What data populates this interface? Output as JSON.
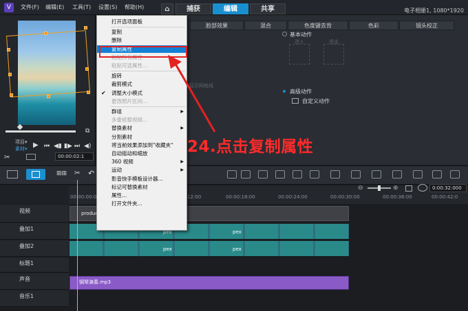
{
  "titlebar": {
    "menus": [
      "文件(F)",
      "编辑(E)",
      "工具(T)",
      "设置(S)",
      "帮助(H)"
    ],
    "home_icon": "home-icon",
    "tabs": [
      "捕获",
      "编辑",
      "共享"
    ],
    "active_tab": "编辑",
    "project_info": "电子相册1, 1080*1920"
  },
  "preview": {
    "labels": {
      "project": "项目▾",
      "clip": "素材▾"
    },
    "timecode": "00:00:02:1"
  },
  "panel": {
    "tabs": [
      "脸部效果",
      "混合",
      "色度键去背",
      "色彩",
      "镜头校正"
    ],
    "basic_motion": "基本动作",
    "enter_label": "进入",
    "exit_label": "退出",
    "show_grid": "显示网格线",
    "advanced_motion": "高级动作",
    "custom_motion": "自定义动作"
  },
  "context_menu": {
    "items": [
      {
        "label": "打开选项面板",
        "disabled": false,
        "submenu": false
      },
      {
        "label": "复制",
        "disabled": false,
        "submenu": false
      },
      {
        "label": "删除",
        "disabled": false,
        "submenu": false
      },
      {
        "label": "复制属性",
        "disabled": false,
        "submenu": false,
        "selected": true
      },
      {
        "label": "粘贴所有属性",
        "disabled": true,
        "submenu": false
      },
      {
        "label": "粘贴可选属性...",
        "disabled": true,
        "submenu": false
      },
      {
        "label": "旋转",
        "disabled": false,
        "submenu": false
      },
      {
        "label": "裁剪模式",
        "disabled": false,
        "submenu": false
      },
      {
        "label": "调整大小模式",
        "disabled": false,
        "submenu": false,
        "checked": true
      },
      {
        "label": "更改照片区间...",
        "disabled": true,
        "submenu": false
      },
      {
        "label": "群组",
        "disabled": false,
        "submenu": true
      },
      {
        "label": "多重修整视频...",
        "disabled": true,
        "submenu": false
      },
      {
        "label": "替换素材",
        "disabled": false,
        "submenu": true
      },
      {
        "label": "分割素材",
        "disabled": false,
        "submenu": false
      },
      {
        "label": "将当前效果添加到\"收藏夹\"",
        "disabled": false,
        "submenu": false
      },
      {
        "label": "自动摇动和缩放",
        "disabled": false,
        "submenu": false
      },
      {
        "label": "360 视频",
        "disabled": false,
        "submenu": true
      },
      {
        "label": "运动",
        "disabled": false,
        "submenu": true
      },
      {
        "label": "影音快手模板设计器...",
        "disabled": false,
        "submenu": false
      },
      {
        "label": "标记可替换素材",
        "disabled": false,
        "submenu": false
      },
      {
        "label": "属性...",
        "disabled": false,
        "submenu": false
      },
      {
        "label": "打开文件夹...",
        "disabled": false,
        "submenu": false
      }
    ]
  },
  "annotation": "24.点击复制属性",
  "timeline": {
    "ruler_times": [
      "00:00:00:00",
      "12:00",
      "00:00:18:00",
      "00:00:24:00",
      "00:00:30:00",
      "00:00:36:00",
      "00:00:42:0"
    ],
    "duration": "0:00:32:000",
    "tracks": [
      "视频",
      "叠加1",
      "叠加2",
      "标题1",
      "声音",
      "音乐1"
    ],
    "video_clip_label": "product",
    "overlay_clip_label": "pex",
    "audio_clip_label": "钢琴演奏.mp3",
    "colors": {
      "accent": "#1a8fd0",
      "audio": "#8a5bc7",
      "clip": "#2a8a8a",
      "highlight": "#e32222"
    }
  }
}
